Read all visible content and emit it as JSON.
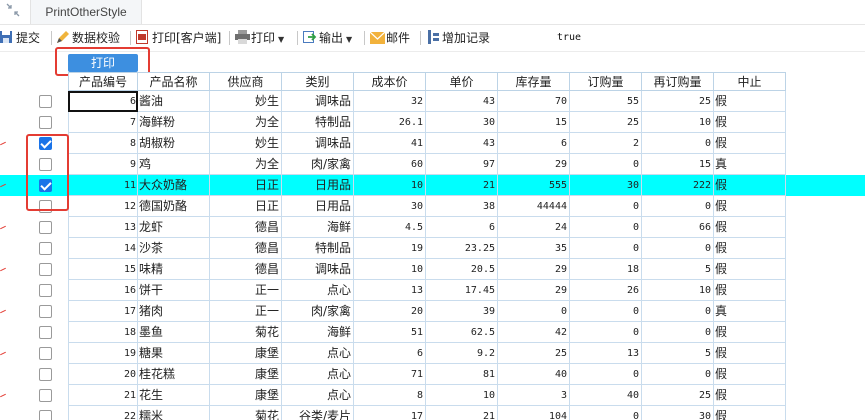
{
  "tab": {
    "collapse_icon": "arrows-collapse-icon",
    "title": "PrintOtherStyle"
  },
  "toolbar": {
    "submit": "提交",
    "verify": "数据校验",
    "print_client": "打印[客户端]",
    "print": "打印",
    "export": "输出",
    "mail": "邮件",
    "add_record": "增加记录",
    "status": "true"
  },
  "print_button": "打印",
  "columns": [
    "产品编号",
    "产品名称",
    "供应商",
    "类别",
    "成本价",
    "单价",
    "库存量",
    "订购量",
    "再订购量",
    "中止"
  ],
  "colors": {
    "highlight": "#00ffff",
    "accent": "#3d8fe0",
    "annotation": "#e43c33",
    "checkbox": "#1a73e8"
  },
  "rows": [
    {
      "id": "6",
      "name": "酱油",
      "supplier": "妙生",
      "category": "调味品",
      "cost": "32",
      "price": "43",
      "stock": "70",
      "ordered": "55",
      "reorder": "25",
      "stop": "假",
      "checked": false,
      "highlight": false
    },
    {
      "id": "7",
      "name": "海鲜粉",
      "supplier": "为全",
      "category": "特制品",
      "cost": "26.1",
      "price": "30",
      "stock": "15",
      "ordered": "25",
      "reorder": "10",
      "stop": "假",
      "checked": false,
      "highlight": false
    },
    {
      "id": "8",
      "name": "胡椒粉",
      "supplier": "妙生",
      "category": "调味品",
      "cost": "41",
      "price": "43",
      "stock": "6",
      "ordered": "2",
      "reorder": "0",
      "stop": "假",
      "checked": true,
      "highlight": false
    },
    {
      "id": "9",
      "name": "鸡",
      "supplier": "为全",
      "category": "肉/家禽",
      "cost": "60",
      "price": "97",
      "stock": "29",
      "ordered": "0",
      "reorder": "15",
      "stop": "真",
      "checked": false,
      "highlight": false
    },
    {
      "id": "11",
      "name": "大众奶酪",
      "supplier": "日正",
      "category": "日用品",
      "cost": "10",
      "price": "21",
      "stock": "555",
      "ordered": "30",
      "reorder": "222",
      "stop": "假",
      "checked": true,
      "highlight": true
    },
    {
      "id": "12",
      "name": "德国奶酪",
      "supplier": "日正",
      "category": "日用品",
      "cost": "30",
      "price": "38",
      "stock": "44444",
      "ordered": "0",
      "reorder": "0",
      "stop": "假",
      "checked": false,
      "highlight": false
    },
    {
      "id": "13",
      "name": "龙虾",
      "supplier": "德昌",
      "category": "海鲜",
      "cost": "4.5",
      "price": "6",
      "stock": "24",
      "ordered": "0",
      "reorder": "66",
      "stop": "假",
      "checked": false,
      "highlight": false
    },
    {
      "id": "14",
      "name": "沙茶",
      "supplier": "德昌",
      "category": "特制品",
      "cost": "19",
      "price": "23.25",
      "stock": "35",
      "ordered": "0",
      "reorder": "0",
      "stop": "假",
      "checked": false,
      "highlight": false
    },
    {
      "id": "15",
      "name": "味精",
      "supplier": "德昌",
      "category": "调味品",
      "cost": "10",
      "price": "20.5",
      "stock": "29",
      "ordered": "18",
      "reorder": "5",
      "stop": "假",
      "checked": false,
      "highlight": false
    },
    {
      "id": "16",
      "name": "饼干",
      "supplier": "正一",
      "category": "点心",
      "cost": "13",
      "price": "17.45",
      "stock": "29",
      "ordered": "26",
      "reorder": "10",
      "stop": "假",
      "checked": false,
      "highlight": false
    },
    {
      "id": "17",
      "name": "猪肉",
      "supplier": "正一",
      "category": "肉/家禽",
      "cost": "20",
      "price": "39",
      "stock": "0",
      "ordered": "0",
      "reorder": "0",
      "stop": "真",
      "checked": false,
      "highlight": false
    },
    {
      "id": "18",
      "name": "墨鱼",
      "supplier": "菊花",
      "category": "海鲜",
      "cost": "51",
      "price": "62.5",
      "stock": "42",
      "ordered": "0",
      "reorder": "0",
      "stop": "假",
      "checked": false,
      "highlight": false
    },
    {
      "id": "19",
      "name": "糖果",
      "supplier": "康堡",
      "category": "点心",
      "cost": "6",
      "price": "9.2",
      "stock": "25",
      "ordered": "13",
      "reorder": "5",
      "stop": "假",
      "checked": false,
      "highlight": false
    },
    {
      "id": "20",
      "name": "桂花糕",
      "supplier": "康堡",
      "category": "点心",
      "cost": "71",
      "price": "81",
      "stock": "40",
      "ordered": "0",
      "reorder": "0",
      "stop": "假",
      "checked": false,
      "highlight": false
    },
    {
      "id": "21",
      "name": "花生",
      "supplier": "康堡",
      "category": "点心",
      "cost": "8",
      "price": "10",
      "stock": "3",
      "ordered": "40",
      "reorder": "25",
      "stop": "假",
      "checked": false,
      "highlight": false
    },
    {
      "id": "22",
      "name": "糯米",
      "supplier": "菊花",
      "category": "谷类/麦片",
      "cost": "17",
      "price": "21",
      "stock": "104",
      "ordered": "0",
      "reorder": "30",
      "stop": "假",
      "checked": false,
      "highlight": false
    }
  ]
}
